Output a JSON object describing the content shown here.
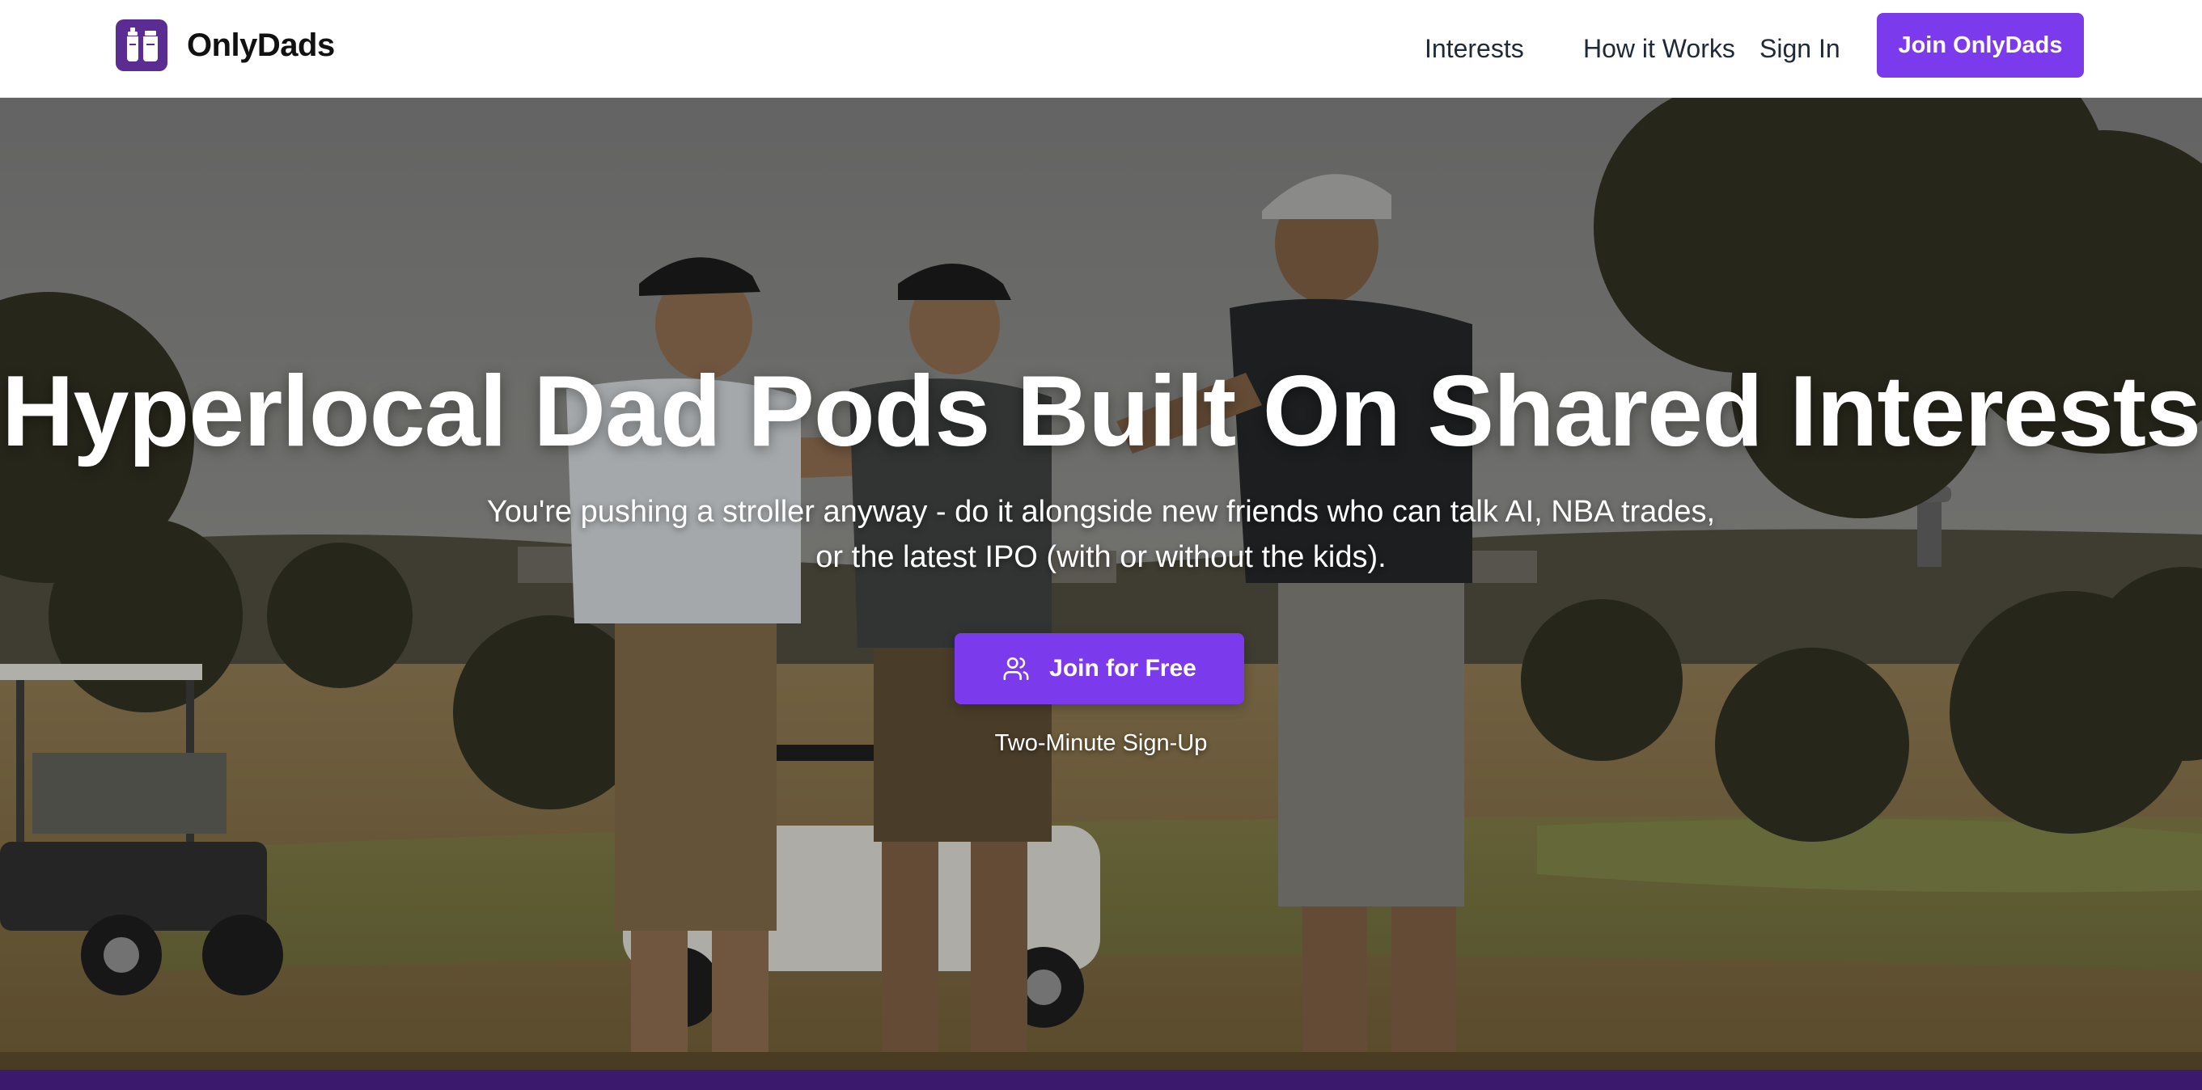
{
  "header": {
    "brand_name": "OnlyDads",
    "logo_icon": "baby-bottles-icon",
    "nav": {
      "interests": "Interests",
      "how_it_works": "How it Works",
      "sign_in": "Sign In",
      "join": "Join OnlyDads"
    }
  },
  "hero": {
    "title": "Hyperlocal Dad Pods Built On Shared Interests",
    "subtitle": "You're pushing a stroller anyway - do it alongside new friends who can talk AI, NBA trades, or the latest IPO (with or without the kids).",
    "cta_label": "Join for Free",
    "cta_icon": "users-icon",
    "cta_note": "Two-Minute Sign-Up",
    "background_image": "golfers-toasting-on-course"
  },
  "colors": {
    "accent": "#7c3aed",
    "logo_bg": "#5b2c91",
    "footer_band": "#3b1a6e"
  }
}
